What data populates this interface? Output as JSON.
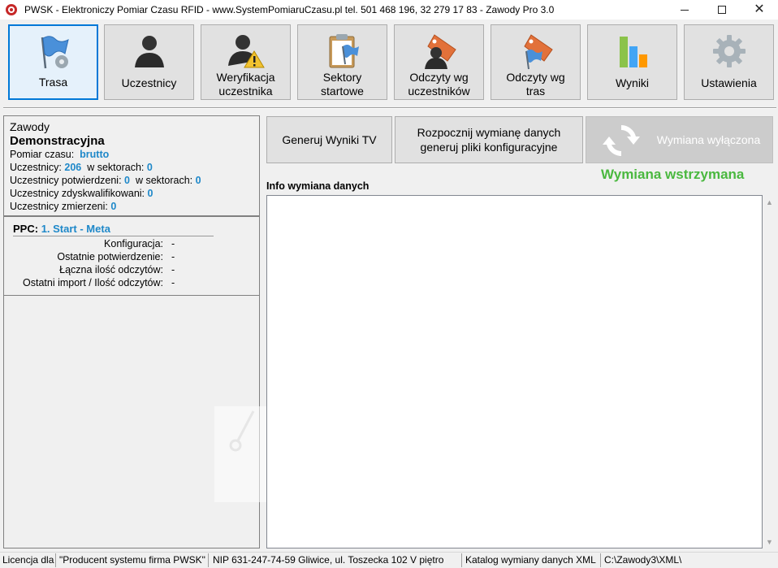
{
  "window": {
    "title": "PWSK - Elektroniczy Pomiar Czasu RFID - www.SystemPomiaruCzasu.pl tel. 501 468 196,  32 279 17 83 - Zawody Pro 3.0",
    "minimize_icon": "minimize-icon",
    "maximize_icon": "maximize-icon",
    "close_glyph": "✕"
  },
  "toolbar": {
    "trasa": "Trasa",
    "uczestnicy": "Uczestnicy",
    "weryfikacja_l1": "Weryfikacja",
    "weryfikacja_l2": "uczestnika",
    "sektory_l1": "Sektory",
    "sektory_l2": "startowe",
    "odczyty_ucz_l1": "Odczyty wg",
    "odczyty_ucz_l2": "uczestników",
    "odczyty_tras_l1": "Odczyty wg",
    "odczyty_tras_l2": "tras",
    "wyniki": "Wyniki",
    "ustawienia": "Ustawienia"
  },
  "zawody": {
    "label": "Zawody",
    "name": "Demonstracyjna",
    "pomiar_label": "Pomiar czasu:",
    "pomiar_value": "brutto",
    "uczestnicy_label": "Uczestnicy:",
    "uczestnicy_value": "206",
    "sektory_label": "w sektorach:",
    "sektory_value": "0",
    "potwierdzeni_label": "Uczestnicy potwierdzeni:",
    "potwierdzeni_value": "0",
    "potw_sektory_label": "w sektorach:",
    "potw_sektory_value": "0",
    "zdyskw_label": "Uczestnicy zdyskwalifikowani:",
    "zdyskw_value": "0",
    "zmierzeni_label": "Uczestnicy zmierzeni:",
    "zmierzeni_value": "0"
  },
  "ppc": {
    "label": "PPC:",
    "value": "1. Start - Meta",
    "konfiguracja_label": "Konfiguracja:",
    "konfiguracja_value": "-",
    "potwierdzenie_label": "Ostatnie potwierdzenie:",
    "potwierdzenie_value": "-",
    "odczyty_label": "Łączna ilość odczytów:",
    "odczyty_value": "-",
    "import_label": "Ostatni import / Ilość odczytów:",
    "import_value": "-"
  },
  "actions": {
    "generuj_tv": "Generuj Wyniki TV",
    "rozpocznij_l1": "Rozpocznij wymianę danych",
    "rozpocznij_l2": "generuj pliki konfiguracyjne",
    "wymiana_wylaczona": "Wymiana wyłączona"
  },
  "status": {
    "wymiana": "Wymiana wstrzymana",
    "color": "#4ab83f"
  },
  "info": {
    "label": "Info wymiana danych"
  },
  "statusbar": {
    "licencja": "Licencja dla",
    "producent": "\"Producent systemu firma PWSK\"",
    "nip": "NIP 631-247-74-59  Gliwice, ul. Toszecka 102 V piętro",
    "katalog": "Katalog wymiany danych XML",
    "sciezka": "C:\\Zawody3\\XML\\"
  },
  "scrollbar": {
    "up": "▲",
    "down": "▼"
  }
}
